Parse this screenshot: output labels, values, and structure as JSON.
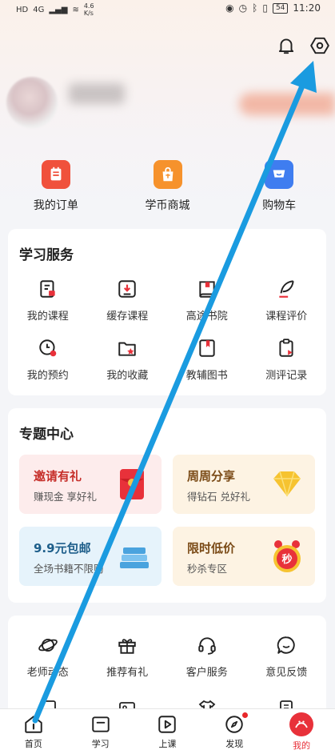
{
  "status_bar": {
    "left_signal_1": "HD",
    "left_signal_2": "4G",
    "speed": "4.6",
    "speed_unit": "K/s",
    "battery": "54",
    "time": "11:20"
  },
  "quick_actions": [
    {
      "label": "我的订单",
      "icon": "order-icon",
      "color": "#f0513c"
    },
    {
      "label": "学币商城",
      "icon": "shop-bag-icon",
      "color": "#f6922c"
    },
    {
      "label": "购物车",
      "icon": "cart-icon",
      "color": "#3f7df0"
    }
  ],
  "learning_services": {
    "title": "学习服务",
    "items": [
      {
        "label": "我的课程",
        "icon": "course-icon"
      },
      {
        "label": "缓存课程",
        "icon": "download-icon"
      },
      {
        "label": "高途书院",
        "icon": "book-icon"
      },
      {
        "label": "课程评价",
        "icon": "feather-icon"
      },
      {
        "label": "我的预约",
        "icon": "clock-icon"
      },
      {
        "label": "我的收藏",
        "icon": "folder-star-icon"
      },
      {
        "label": "教辅图书",
        "icon": "bookmark-book-icon"
      },
      {
        "label": "测评记录",
        "icon": "clipboard-icon"
      }
    ]
  },
  "topic_center": {
    "title": "专题中心",
    "items": [
      {
        "title": "邀请有礼",
        "sub": "赚现金 享好礼",
        "bg": "#fdecec",
        "title_color": "#c62f2a",
        "pic": "red-envelope-icon"
      },
      {
        "title": "周周分享",
        "sub": "得钻石 兑好礼",
        "bg": "#fdf3e3",
        "title_color": "#7a4a16",
        "pic": "diamond-icon"
      },
      {
        "title": "9.9元包邮",
        "sub": "全场书籍不限购",
        "bg": "#e6f3fb",
        "title_color": "#1d5e8a",
        "pic": "books-icon"
      },
      {
        "title": "限时低价",
        "sub": "秒杀专区",
        "bg": "#fdf3e3",
        "title_color": "#7a4a16",
        "pic": "alarm-clock-icon",
        "pic_text": "秒"
      }
    ]
  },
  "more_services": {
    "items": [
      {
        "label": "老师动态",
        "icon": "planet-icon"
      },
      {
        "label": "推荐有礼",
        "icon": "gift-icon"
      },
      {
        "label": "客户服务",
        "icon": "headset-icon"
      },
      {
        "label": "意见反馈",
        "icon": "chat-smile-icon"
      }
    ]
  },
  "tabbar": [
    {
      "label": "首页",
      "icon": "home-icon"
    },
    {
      "label": "学习",
      "icon": "study-icon"
    },
    {
      "label": "上课",
      "icon": "play-icon"
    },
    {
      "label": "发现",
      "icon": "compass-icon",
      "dot": true
    },
    {
      "label": "我的",
      "icon": "mine-icon",
      "active": true
    }
  ],
  "colors": {
    "accent_red": "#e8313a",
    "arrow_blue": "#1a9be0"
  }
}
